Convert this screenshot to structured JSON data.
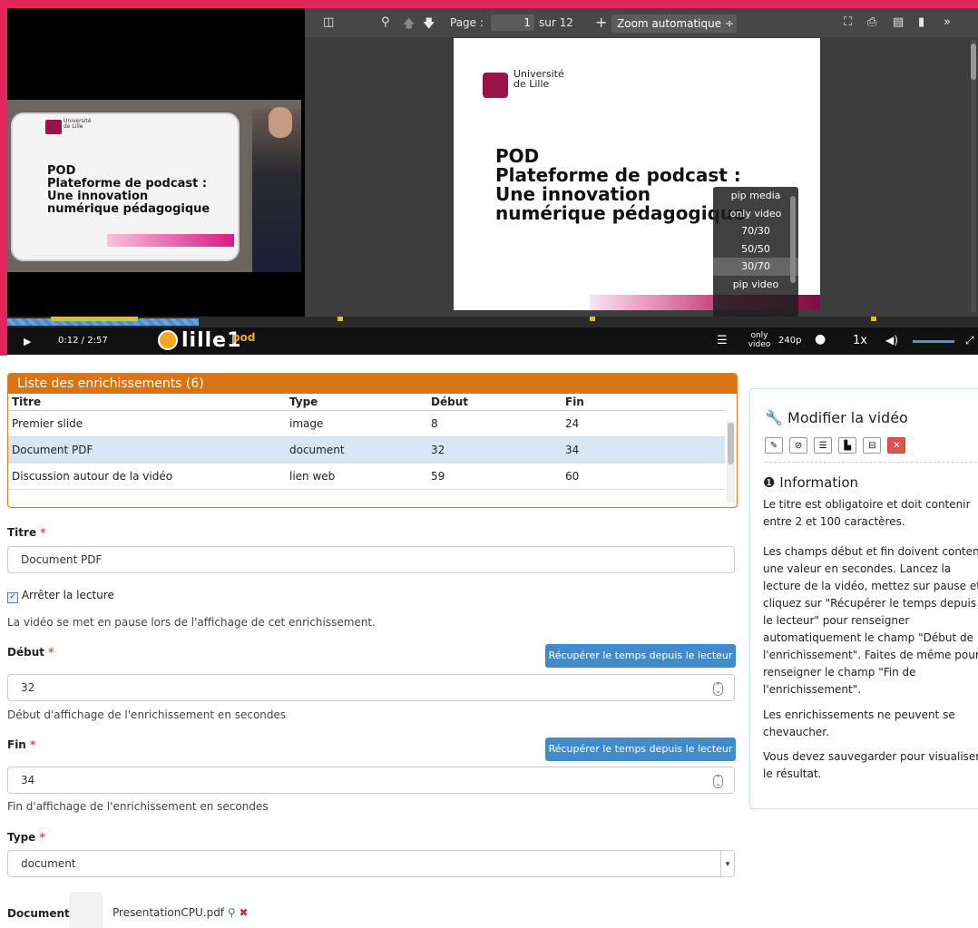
{
  "pdf_toolbar": {
    "page_label": "Page :",
    "page_value": "1",
    "page_total": "sur 12",
    "zoom": "Zoom automatique"
  },
  "thumb_slide": {
    "logo_text": [
      "Université",
      "de Lille"
    ],
    "title_lines": [
      "POD",
      "Plateforme de podcast :",
      "Une innovation",
      "numérique pédagogique"
    ]
  },
  "pdf_page": {
    "logo_text": [
      "Université",
      "de Lille"
    ],
    "title_lines": [
      "POD",
      "Plateforme de podcast :",
      "Une innovation",
      "numérique pédagogique"
    ]
  },
  "layout_menu": {
    "items": [
      "pip media",
      "only video",
      "70/30",
      "50/50",
      "30/70",
      "pip video"
    ],
    "selected": "30/70"
  },
  "player": {
    "current_time": "0:12",
    "separator": "/",
    "duration": "2:57",
    "brand": "lille1",
    "brand_suffix": "pod",
    "layout_label": "only video",
    "quality": "240p",
    "speed": "1x",
    "progress_fraction": 0.068,
    "marker_fractions": [
      0.045,
      0.34,
      0.6,
      0.89
    ]
  },
  "enrichments_panel": {
    "title": "Liste des enrichissements (6)",
    "columns": [
      "Titre",
      "Type",
      "Début",
      "Fin"
    ],
    "rows": [
      [
        "Premier slide",
        "image",
        "8",
        "24"
      ],
      [
        "Document PDF",
        "document",
        "32",
        "34"
      ],
      [
        "Discussion autour de la vidéo",
        "lien web",
        "59",
        "60"
      ]
    ],
    "selected_row": 1
  },
  "form": {
    "title_label": "Titre",
    "title_value": "Document PDF",
    "stop_label": "Arrêter la lecture",
    "stop_help": "La vidéo se met en pause lors de l'affichage de cet enrichissement.",
    "start_label": "Début",
    "start_value": "32",
    "start_help": "Début d'affichage de l'enrichissement en secondes",
    "end_label": "Fin",
    "end_value": "34",
    "end_help": "Fin d'affichage de l'enrichissement en secondes",
    "get_time_button": "Récupérer le temps depuis le lecteur",
    "type_label": "Type",
    "type_value": "document",
    "document_label": "Document",
    "document_file": "PresentationCPU.pdf",
    "required_mark": "*"
  },
  "sidebar": {
    "title": "Modifier la vidéo",
    "info_title": "Information",
    "paragraphs": [
      "Le titre est obligatoire et doit contenir entre 2 et 100 caractères.",
      "Les champs début et fin doivent contenir une valeur en secondes. Lancez la lecture de la vidéo, mettez sur pause et cliquez sur \"Récupérer le temps depuis le lecteur\" pour renseigner automatiquement le champ \"Début de l'enrichissement\". Faites de même pour renseigner le champ \"Fin de l'enrichissement\".",
      "Les enrichissements ne peuvent se chevaucher.",
      "Vous devez sauvegarder pour visualiser le résultat."
    ]
  },
  "colors": {
    "accent_pink": "#e2255d",
    "panel_orange": "#d87416",
    "button_blue": "#428bca"
  }
}
